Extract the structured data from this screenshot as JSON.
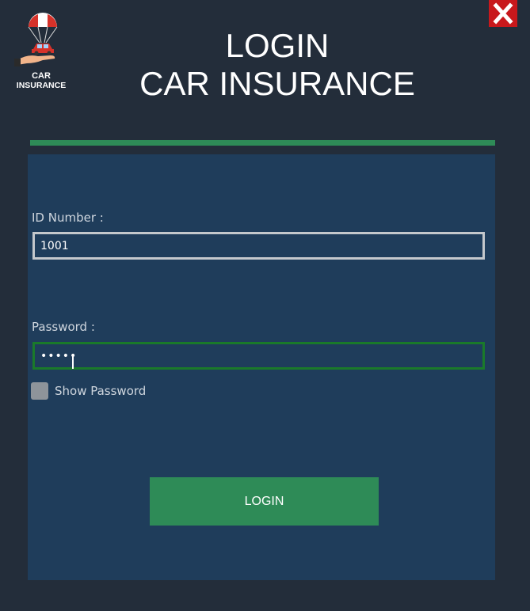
{
  "app": {
    "logo_line1": "CAR",
    "logo_line2": "INSURANCE",
    "title_line1": "LOGIN",
    "title_line2": "CAR INSURANCE"
  },
  "form": {
    "id_label": "ID Number :",
    "id_value": "1001",
    "password_label": "Password :",
    "password_value": "•••••",
    "show_password_label": "Show Password",
    "login_label": "LOGIN"
  },
  "icons": {
    "close": "close-icon",
    "logo": "parachute-car-logo"
  },
  "colors": {
    "background": "#232d3a",
    "panel": "#1f3d5b",
    "accent_green": "#2e8b57",
    "close_red": "#c8181c",
    "focus_border": "#1a7a2a"
  }
}
